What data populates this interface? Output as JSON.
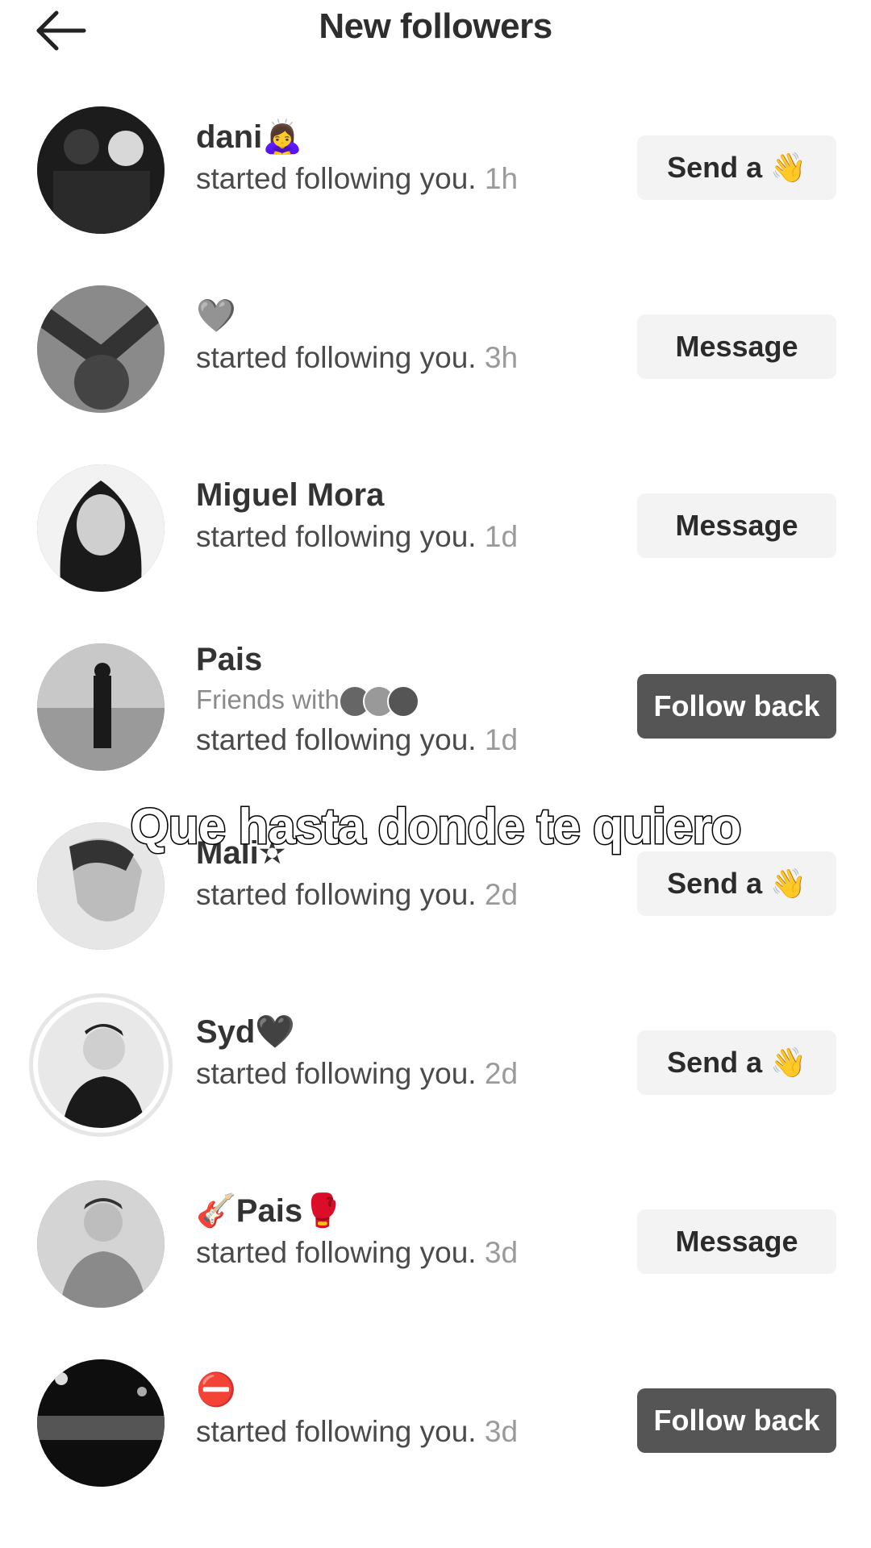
{
  "header": {
    "title": "New followers"
  },
  "followers": [
    {
      "name": "dani🙇‍♀️",
      "action": "started following you.",
      "time": "1h",
      "button": "Send a",
      "button_wave": "👋"
    },
    {
      "name": "🩶",
      "action": "started following you.",
      "time": "3h",
      "button": "Message"
    },
    {
      "name": "Miguel  Mora",
      "action": "started following you.",
      "time": "1d",
      "button": "Message"
    },
    {
      "name": "Pais",
      "friends": "Friends with",
      "action": "started following you.",
      "time": "1d",
      "button": "Follow back"
    },
    {
      "name": "Mali✫",
      "action": "started following you.",
      "time": "2d",
      "button": "Send a",
      "button_wave": "👋"
    },
    {
      "name": "Syd🖤",
      "action": "started following you.",
      "time": "2d",
      "button": "Send a",
      "button_wave": "👋"
    },
    {
      "name": "🎸Pais🥊",
      "action": "started following you.",
      "time": "3d",
      "button": "Message"
    },
    {
      "name": "⛔",
      "action": "started following you.",
      "time": "3d",
      "button": "Follow back"
    }
  ],
  "caption": "Que hasta donde te quiero"
}
